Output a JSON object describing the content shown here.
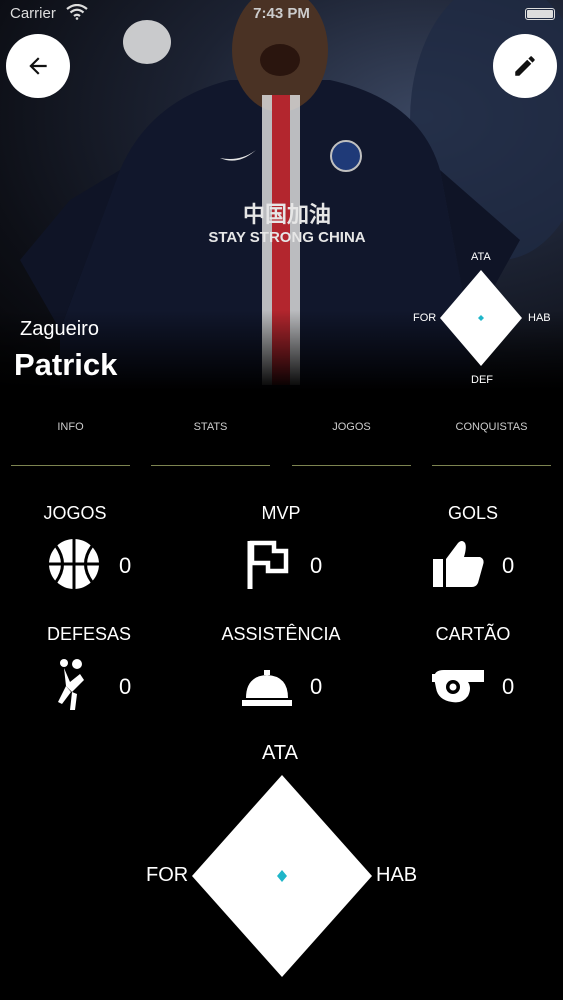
{
  "status_bar": {
    "carrier": "Carrier",
    "time": "7:43 PM"
  },
  "hero": {
    "position": "Zagueiro",
    "name": "Patrick"
  },
  "mini_radar": {
    "top": "ATA",
    "left": "FOR",
    "right": "HAB",
    "bottom": "DEF",
    "accent": "#1fb6c9"
  },
  "tabs": [
    {
      "label": "INFO"
    },
    {
      "label": "STATS"
    },
    {
      "label": "JOGOS"
    },
    {
      "label": "CONQUISTAS"
    }
  ],
  "stats": [
    {
      "title": "JOGOS",
      "value": "0",
      "icon": "basketball-icon"
    },
    {
      "title": "MVP",
      "value": "0",
      "icon": "flag-icon"
    },
    {
      "title": "GOLS",
      "value": "0",
      "icon": "thumbs-up-icon"
    },
    {
      "title": "DEFESAS",
      "value": "0",
      "icon": "handball-player-icon"
    },
    {
      "title": "ASSISTÊNCIA",
      "value": "0",
      "icon": "service-bell-icon"
    },
    {
      "title": "CARTÃO",
      "value": "0",
      "icon": "whistle-icon"
    }
  ],
  "big_radar": {
    "top": "ATA",
    "left": "FOR",
    "right": "HAB"
  },
  "colors": {
    "tab_underline": "#7d8451",
    "radar_dot": "#1fb6c9"
  }
}
